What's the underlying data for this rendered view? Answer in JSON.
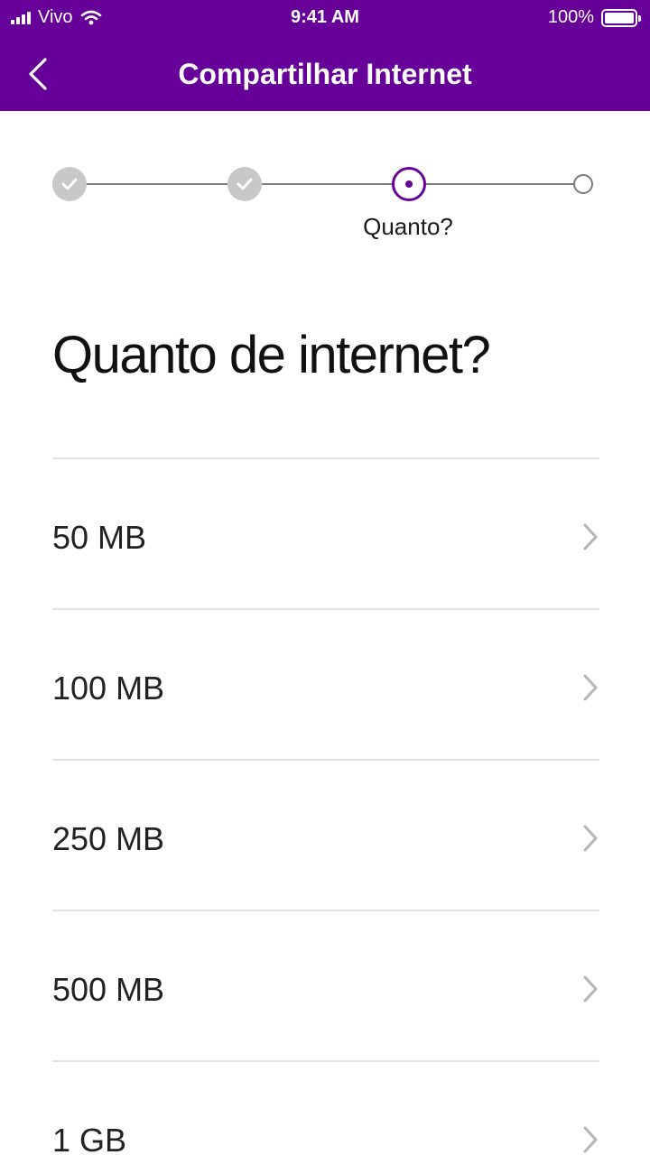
{
  "status_bar": {
    "carrier": "Vivo",
    "time": "9:41 AM",
    "battery": "100%",
    "battery_level": 1.0
  },
  "nav": {
    "title": "Compartilhar Internet",
    "back_icon": "chevron-left-icon"
  },
  "stepper": {
    "current_label": "Quanto?",
    "steps": [
      {
        "state": "done",
        "icon": "check-icon"
      },
      {
        "state": "done",
        "icon": "check-icon"
      },
      {
        "state": "current",
        "icon": "dot-icon"
      },
      {
        "state": "future",
        "icon": "empty-circle-icon"
      }
    ]
  },
  "main": {
    "heading": "Quanto de internet?",
    "options": [
      {
        "label": "50 MB"
      },
      {
        "label": "100 MB"
      },
      {
        "label": "250 MB"
      },
      {
        "label": "500 MB"
      },
      {
        "label": "1 GB"
      }
    ]
  },
  "colors": {
    "brand": "#660099",
    "done_step": "#c8c8c8",
    "divider": "#e2e2e2",
    "chevron": "#b5b5b5"
  }
}
